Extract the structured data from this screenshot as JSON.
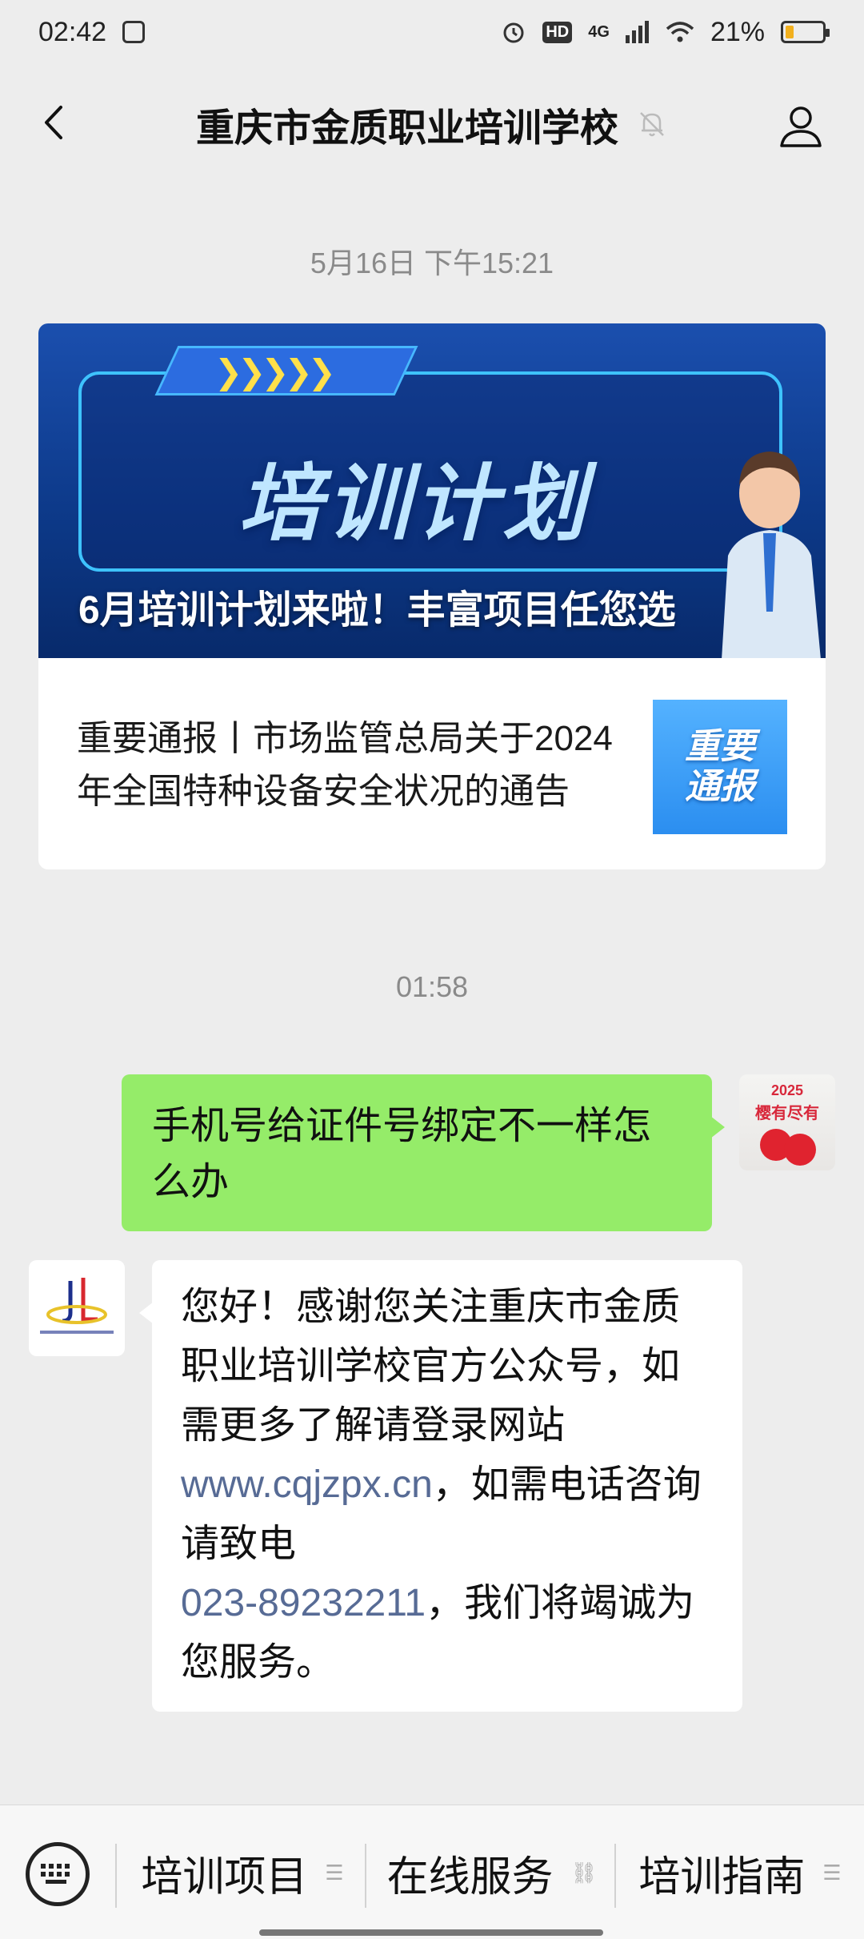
{
  "status_bar": {
    "time": "02:42",
    "network": "4G",
    "hd": "HD",
    "battery": "21%"
  },
  "header": {
    "title": "重庆市金质职业培训学校"
  },
  "timestamps": {
    "first": "5月16日 下午15:21",
    "second": "01:58"
  },
  "article": {
    "banner_heading": "培训计划",
    "banner_caption": "6月培训计划来啦！丰富项目任您选",
    "sub_title": "重要通报丨市场监管总局关于2024年全国特种设备安全状况的通告",
    "sub_thumb_line1": "重要",
    "sub_thumb_line2": "通报"
  },
  "messages": {
    "me": {
      "text": "手机号给证件号绑定不一样怎么办",
      "avatar_year": "2025",
      "avatar_text": "樱有尽有"
    },
    "bot": {
      "text_part1": "您好！感谢您关注重庆市金质职业培训学校官方公众号，如需更多了解请登录网站 ",
      "website": "www.cqjzpx.cn",
      "text_part2": "，如需电话咨询请致电",
      "phone": "023-89232211",
      "text_part3": "，我们将竭诚为您服务。"
    }
  },
  "menu": {
    "items": [
      {
        "label": "培训项目",
        "icon": "list-icon"
      },
      {
        "label": "在线服务",
        "icon": "link-icon"
      },
      {
        "label": "培训指南",
        "icon": "list-icon"
      }
    ]
  }
}
